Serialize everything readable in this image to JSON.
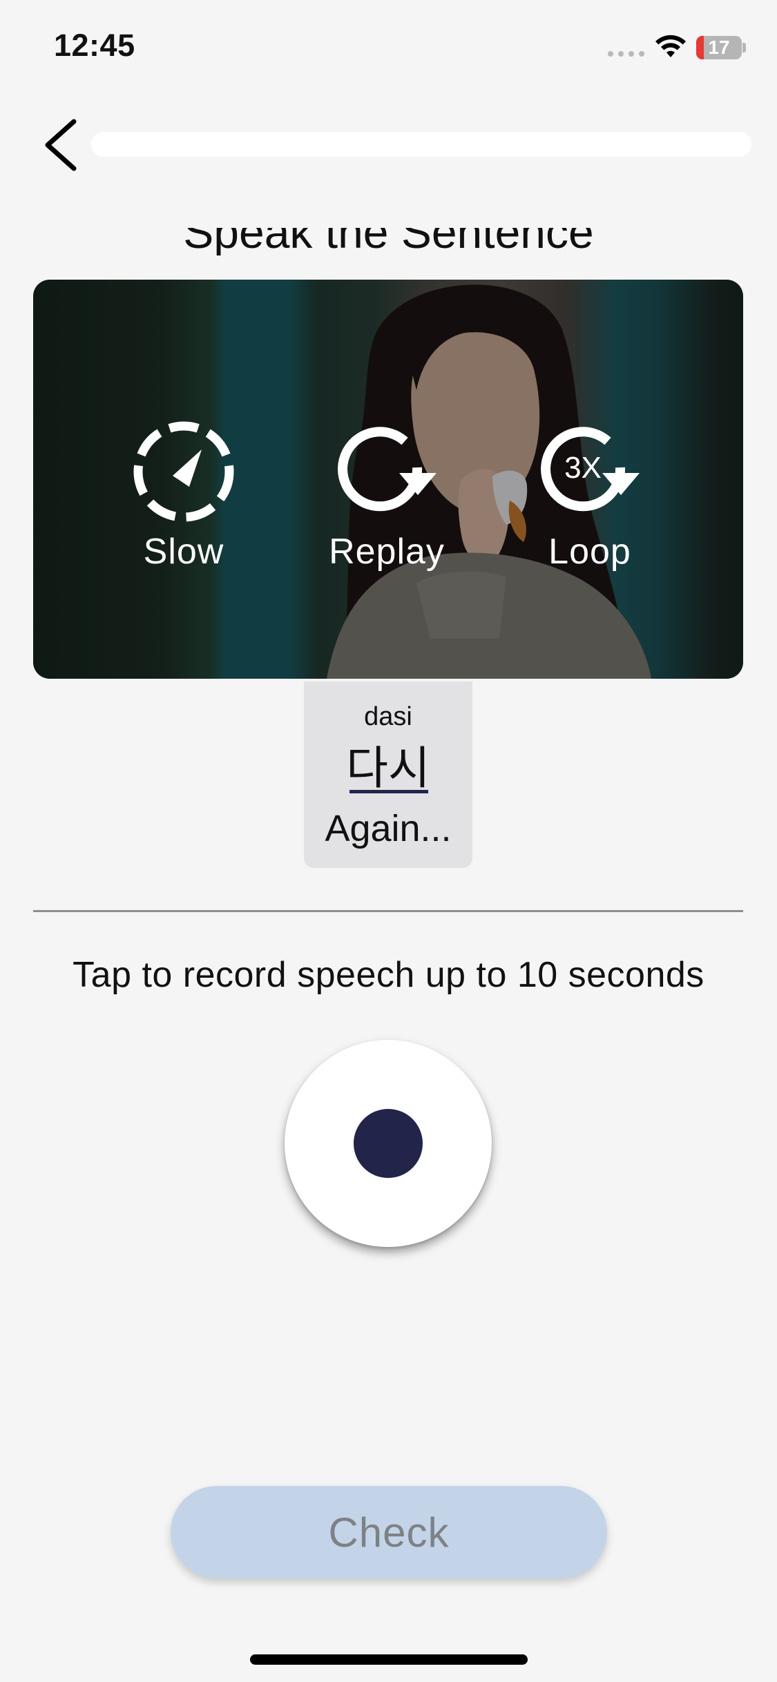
{
  "status_bar": {
    "time": "12:45",
    "battery_level": "17",
    "battery_fraction": 0.17,
    "battery_color": "#e53935"
  },
  "header": {
    "back_icon": "chevron-left-icon",
    "progress_fraction": 1.0
  },
  "page": {
    "title": "Speak the Sentence"
  },
  "video": {
    "controls": [
      {
        "icon": "slow-dial-icon",
        "label": "Slow"
      },
      {
        "icon": "replay-icon",
        "label": "Replay"
      },
      {
        "icon": "loop-icon",
        "badge": "3X",
        "label": "Loop"
      }
    ]
  },
  "word_card": {
    "romanization": "dasi",
    "korean": "다시",
    "meaning": "Again..."
  },
  "recorder": {
    "instruction": "Tap to record speech up to 10 seconds",
    "record_icon": "record-dot-icon",
    "record_color": "#23244a"
  },
  "footer": {
    "check_label": "Check",
    "check_color": "#c3d4e9"
  }
}
